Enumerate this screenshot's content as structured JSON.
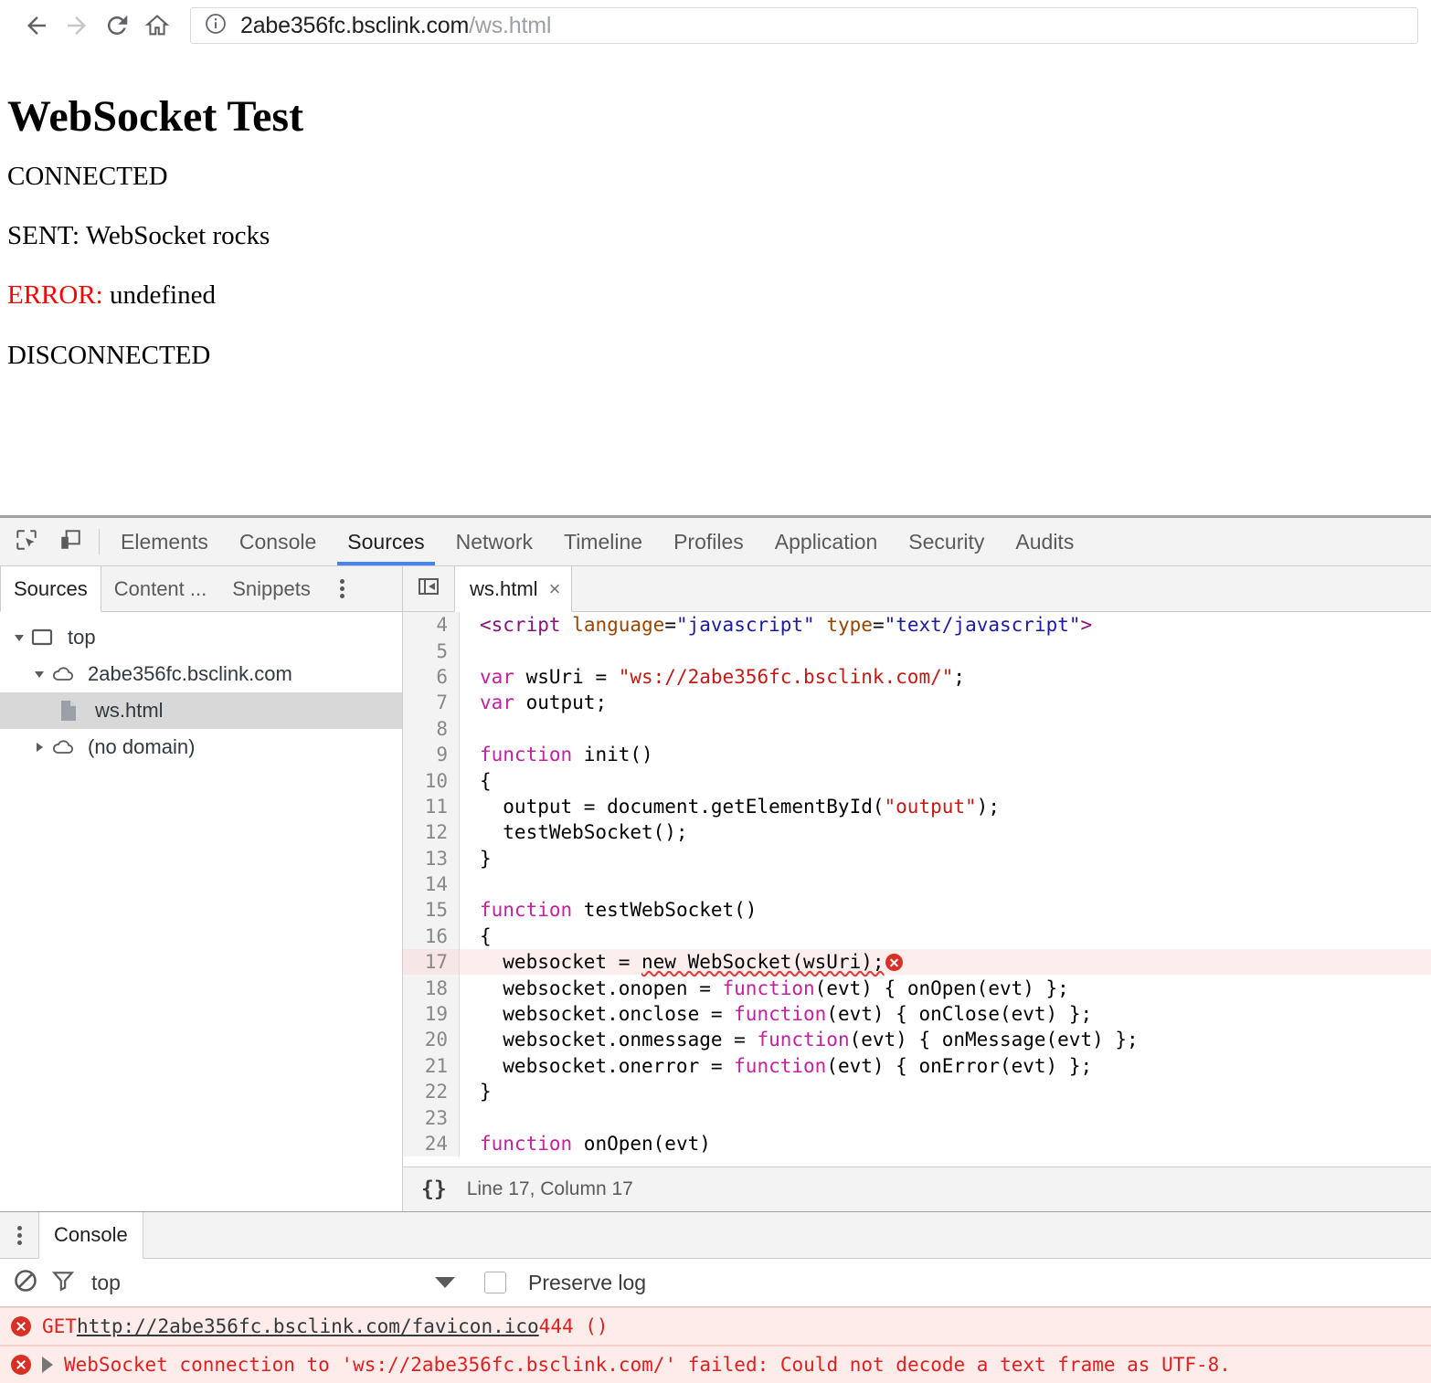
{
  "browser": {
    "back_icon": "back-arrow-icon",
    "forward_icon": "forward-arrow-icon",
    "reload_icon": "reload-icon",
    "home_icon": "home-icon",
    "info_icon": "page-info-icon",
    "url_host": "2abe356fc.bsclink.com",
    "url_path": "/ws.html"
  },
  "page": {
    "title": "WebSocket Test",
    "lines": [
      {
        "label": "",
        "text": "CONNECTED"
      },
      {
        "label": "",
        "text": "SENT: WebSocket rocks"
      },
      {
        "label": "ERROR:",
        "text": " undefined"
      },
      {
        "label": "",
        "text": "DISCONNECTED"
      }
    ],
    "error_color": "#ff0000"
  },
  "devtools": {
    "tabs": [
      {
        "label": "Elements",
        "active": false
      },
      {
        "label": "Console",
        "active": false
      },
      {
        "label": "Sources",
        "active": true
      },
      {
        "label": "Network",
        "active": false
      },
      {
        "label": "Timeline",
        "active": false
      },
      {
        "label": "Profiles",
        "active": false
      },
      {
        "label": "Application",
        "active": false
      },
      {
        "label": "Security",
        "active": false
      },
      {
        "label": "Audits",
        "active": false
      }
    ],
    "active_tab_underline_color": "#4285f4",
    "inspect_icon": "inspect-element-icon",
    "device_icon": "device-toolbar-icon",
    "navigator": {
      "tabs": [
        {
          "label": "Sources",
          "active": true
        },
        {
          "label": "Content ...",
          "active": false
        },
        {
          "label": "Snippets",
          "active": false
        }
      ],
      "more_icon": "kebab-menu-icon",
      "tree": [
        {
          "label": "top",
          "icon": "frame-icon",
          "expanded": true,
          "indent": 0,
          "selected": false
        },
        {
          "label": "2abe356fc.bsclink.com",
          "icon": "cloud-icon",
          "expanded": true,
          "indent": 1,
          "selected": false
        },
        {
          "label": "ws.html",
          "icon": "document-icon",
          "expanded": null,
          "indent": 2,
          "selected": true
        },
        {
          "label": "(no domain)",
          "icon": "cloud-icon",
          "expanded": false,
          "indent": 1,
          "selected": false
        }
      ]
    },
    "editor": {
      "collapse_icon": "collapse-sidebar-icon",
      "tab_label": "ws.html",
      "tab_close": "×",
      "pretty_print_label": "{}",
      "status": "Line 17, Column 17",
      "code": [
        {
          "n": "4",
          "error": false,
          "html": "<span class=\"tok-tag\">&lt;script</span> <span class=\"tok-attr\">language</span>=<span class=\"tok-val\">\"javascript\"</span> <span class=\"tok-attr\">type</span>=<span class=\"tok-val\">\"text/javascript\"</span><span class=\"tok-tag\">&gt;</span>"
        },
        {
          "n": "5",
          "error": false,
          "html": ""
        },
        {
          "n": "6",
          "error": false,
          "html": "<span class=\"tok-kw\">var</span> wsUri = <span class=\"tok-str\">\"ws://2abe356fc.bsclink.com/\"</span>;"
        },
        {
          "n": "7",
          "error": false,
          "html": "<span class=\"tok-kw\">var</span> output;"
        },
        {
          "n": "8",
          "error": false,
          "html": ""
        },
        {
          "n": "9",
          "error": false,
          "html": "<span class=\"tok-kw\">function</span> init()"
        },
        {
          "n": "10",
          "error": false,
          "html": "{"
        },
        {
          "n": "11",
          "error": false,
          "html": "  output = document.getElementById(<span class=\"tok-str\">\"output\"</span>);"
        },
        {
          "n": "12",
          "error": false,
          "html": "  testWebSocket();"
        },
        {
          "n": "13",
          "error": false,
          "html": "}"
        },
        {
          "n": "14",
          "error": false,
          "html": ""
        },
        {
          "n": "15",
          "error": false,
          "html": "<span class=\"tok-kw\">function</span> testWebSocket()"
        },
        {
          "n": "16",
          "error": false,
          "html": "{"
        },
        {
          "n": "17",
          "error": true,
          "html": "  websocket = <span class=\"squig\">new WebSocket(wsUri);</span><span class=\"err-dot\"></span>"
        },
        {
          "n": "18",
          "error": false,
          "html": "  websocket.onopen = <span class=\"tok-kw\">function</span>(evt) { onOpen(evt) };"
        },
        {
          "n": "19",
          "error": false,
          "html": "  websocket.onclose = <span class=\"tok-kw\">function</span>(evt) { onClose(evt) };"
        },
        {
          "n": "20",
          "error": false,
          "html": "  websocket.onmessage = <span class=\"tok-kw\">function</span>(evt) { onMessage(evt) };"
        },
        {
          "n": "21",
          "error": false,
          "html": "  websocket.onerror = <span class=\"tok-kw\">function</span>(evt) { onError(evt) };"
        },
        {
          "n": "22",
          "error": false,
          "html": "}"
        },
        {
          "n": "23",
          "error": false,
          "html": ""
        },
        {
          "n": "24",
          "error": false,
          "html": "<span class=\"tok-kw\">function</span> onOpen(evt)"
        }
      ]
    },
    "drawer": {
      "more_icon": "kebab-menu-icon",
      "tab_label": "Console",
      "clear_icon": "clear-console-icon",
      "filter_icon": "filter-icon",
      "context": "top",
      "context_caret": "chevron-down-icon",
      "preserve_log_label": "Preserve log",
      "preserve_log_checked": false,
      "messages": [
        {
          "icon": "error-icon",
          "expandable": false,
          "parts": [
            {
              "text": "GET ",
              "kind": "text"
            },
            {
              "text": "http://2abe356fc.bsclink.com/favicon.ico",
              "kind": "link"
            },
            {
              "text": " 444 ()",
              "kind": "text"
            }
          ]
        },
        {
          "icon": "error-icon",
          "expandable": true,
          "parts": [
            {
              "text": "WebSocket connection to 'ws://2abe356fc.bsclink.com/' failed: Could not decode a text frame as UTF-8.",
              "kind": "text"
            }
          ]
        }
      ]
    }
  }
}
